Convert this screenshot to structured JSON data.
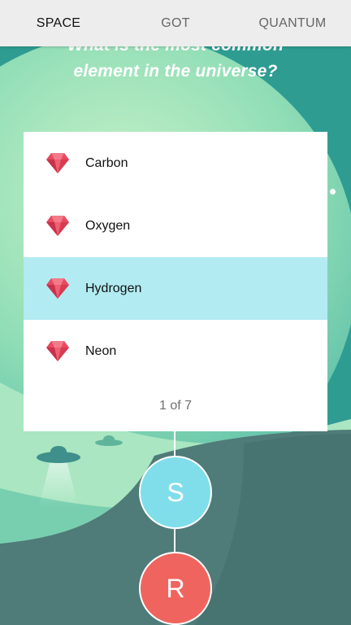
{
  "tabs": [
    {
      "label": "SPACE",
      "active": true
    },
    {
      "label": "GOT",
      "active": false
    },
    {
      "label": "QUANTUM",
      "active": false
    }
  ],
  "question": {
    "line1": "What is the most common",
    "line2": "element in the universe?"
  },
  "options": [
    {
      "label": "Carbon",
      "icon": "ruby-gem-icon",
      "selected": false
    },
    {
      "label": "Oxygen",
      "icon": "ruby-gem-icon",
      "selected": false
    },
    {
      "label": "Hydrogen",
      "icon": "ruby-gem-icon",
      "selected": true
    },
    {
      "label": "Neon",
      "icon": "ruby-gem-icon",
      "selected": false
    }
  ],
  "pager": "1 of 7",
  "buttons": {
    "s_label": "S",
    "r_label": "R"
  },
  "colors": {
    "background_teal": "#2f9c92",
    "selected_row": "#b2ebf2",
    "s_button": "#80deea",
    "r_button": "#f0645f",
    "gem": "#e84a5f"
  }
}
